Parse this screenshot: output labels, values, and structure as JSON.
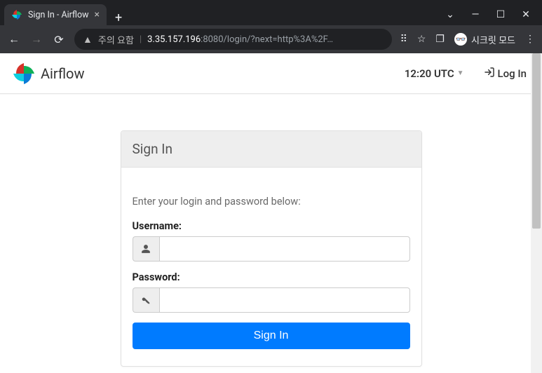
{
  "browser": {
    "tab_title": "Sign In - Airflow",
    "security_label": "주의 요함",
    "url_host": "3.35.157.196",
    "url_port_path": ":8080/login/?next=http%3A%2F…",
    "incognito_label": "시크릿 모드"
  },
  "header": {
    "brand": "Airflow",
    "clock": "12:20 UTC",
    "login_link": "Log In"
  },
  "signin": {
    "title": "Sign In",
    "hint": "Enter your login and password below:",
    "username_label": "Username:",
    "password_label": "Password:",
    "username_value": "",
    "password_value": "",
    "submit": "Sign In"
  }
}
